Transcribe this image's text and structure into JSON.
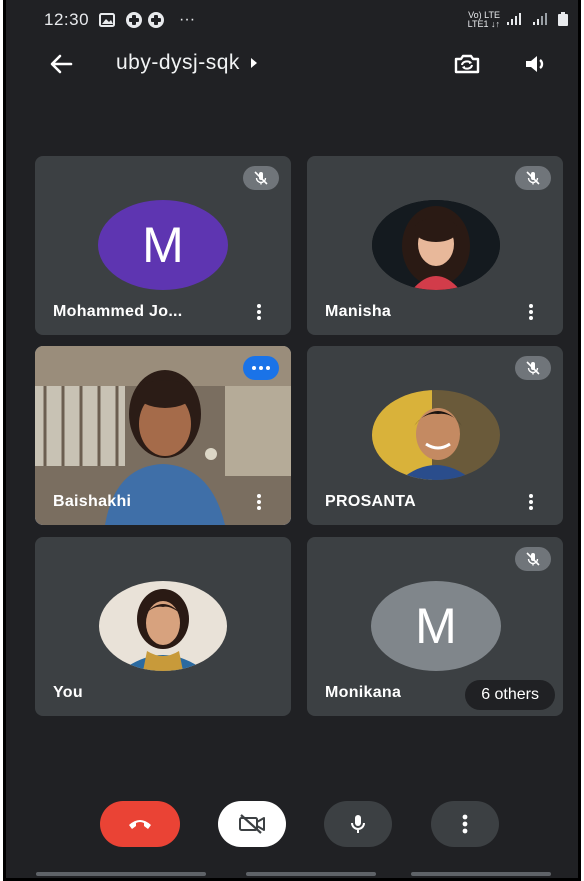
{
  "status_bar": {
    "time": "12:30",
    "icons": [
      "image-icon",
      "call-icon",
      "call-icon"
    ],
    "more": "···",
    "network": "Vo) LTE",
    "network_sub": "LTE1 ↓↑"
  },
  "header": {
    "meeting_code": "uby-dysj-sqk"
  },
  "participants": [
    {
      "name": "Mohammed Jo...",
      "initial": "M",
      "avatar_color": "#5e35b1",
      "muted": true
    },
    {
      "name": "Manisha",
      "muted": true
    },
    {
      "name": "Baishakhi",
      "speaking": true,
      "selected": true
    },
    {
      "name": "PROSANTA",
      "muted": true
    },
    {
      "name": "You"
    },
    {
      "name": "Monikana",
      "initial": "M",
      "avatar_color": "#80868b",
      "muted": true,
      "others": "6 others"
    }
  ],
  "colors": {
    "background": "#202124",
    "tile": "#3c4043",
    "end_call": "#ea4335",
    "accent": "#8ab4f8"
  }
}
